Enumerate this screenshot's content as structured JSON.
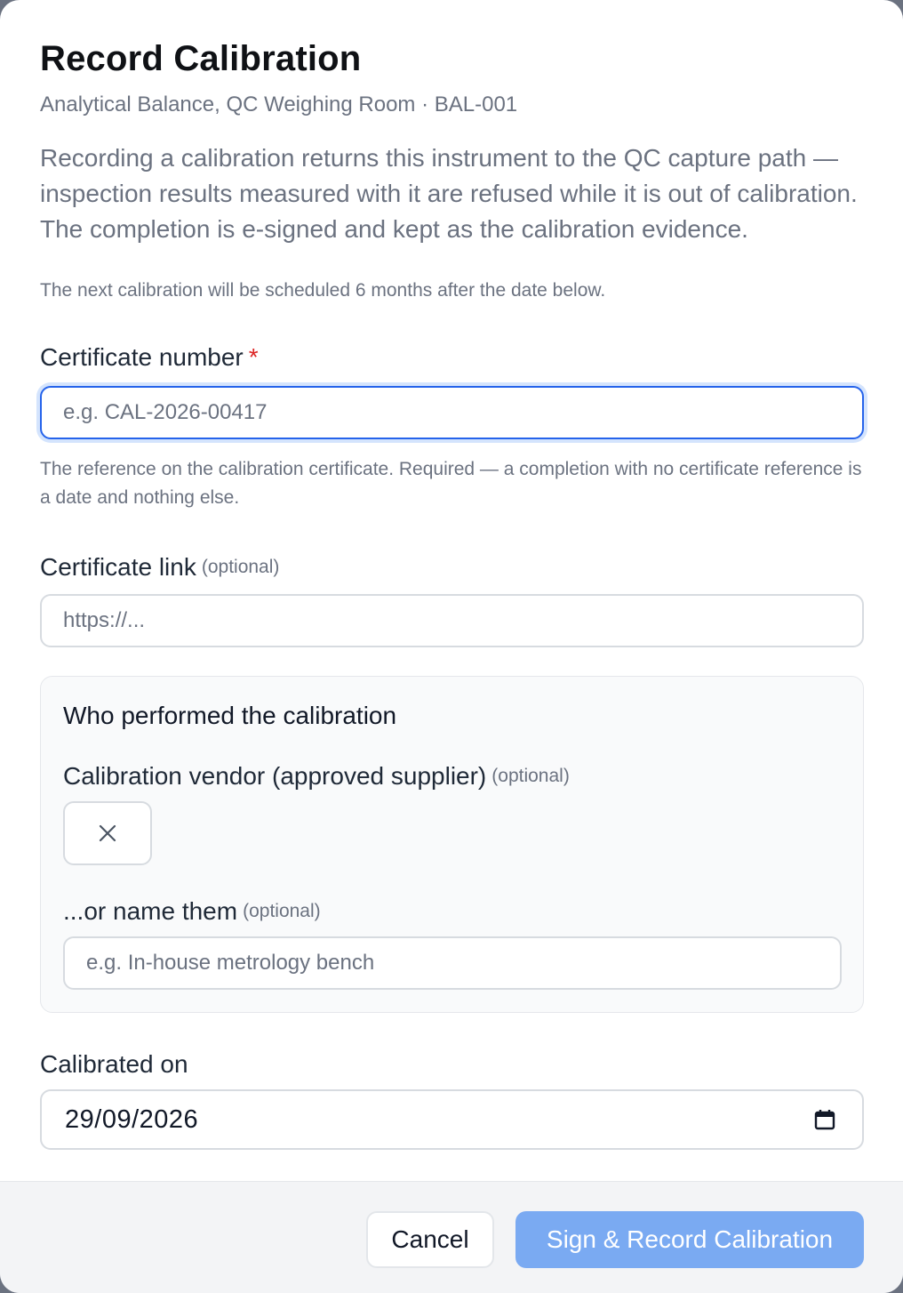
{
  "dialog": {
    "title": "Record Calibration",
    "subtitle": "Analytical Balance, QC Weighing Room · BAL-001",
    "intro": "Recording a calibration returns this instrument to the QC capture path — inspection results measured with it are refused while it is out of calibration. The completion is e-signed and kept as the calibration evidence.",
    "schedule_note": "The next calibration will be scheduled 6 months after the date below."
  },
  "certificate_number": {
    "label": "Certificate number",
    "required_mark": "*",
    "placeholder": "e.g. CAL-2026-00417",
    "value": "",
    "help": "The reference on the calibration certificate. Required — a completion with no certificate reference is a date and nothing else."
  },
  "certificate_link": {
    "label": "Certificate link",
    "optional": "(optional)",
    "placeholder": "https://...",
    "value": ""
  },
  "performer": {
    "title": "Who performed the calibration",
    "vendor": {
      "label": "Calibration vendor (approved supplier)",
      "optional": "(optional)",
      "clear_icon": "close-icon"
    },
    "name": {
      "label": "...or name them",
      "optional": "(optional)",
      "placeholder": "e.g. In-house metrology bench",
      "value": ""
    }
  },
  "calibrated_on": {
    "label": "Calibrated on",
    "value": "29/09/2026",
    "icon": "calendar-icon"
  },
  "footer": {
    "cancel_label": "Cancel",
    "submit_label": "Sign & Record Calibration"
  },
  "colors": {
    "primary_button": "#7aaaf2",
    "focus_ring": "#2563eb",
    "required": "#dc2626"
  }
}
